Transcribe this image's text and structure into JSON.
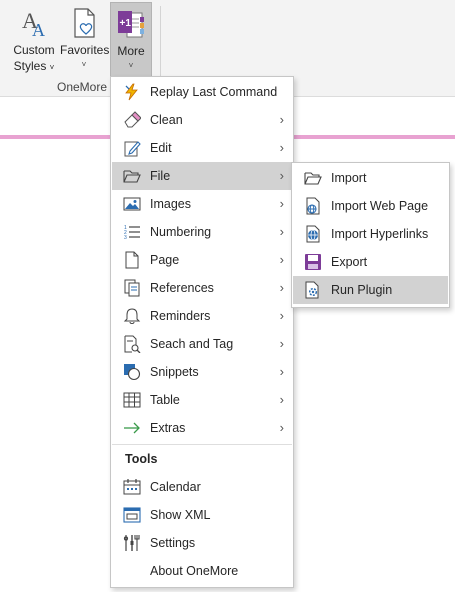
{
  "ribbon": {
    "buttons": [
      {
        "label": "Custom\nStyles",
        "label1": "Custom",
        "label2": "Styles",
        "icon": "custom-styles-icon",
        "chevron": "˅"
      },
      {
        "label": "Favorites",
        "icon": "favorites-icon",
        "chevron": "˅"
      },
      {
        "label": "More",
        "icon": "onenote-more-icon",
        "chevron": "˅"
      }
    ],
    "group_label": "OneMore"
  },
  "menu": {
    "items": [
      {
        "label": "Replay Last Command",
        "icon": "lightning-icon",
        "submenu": false
      },
      {
        "label": "Clean",
        "icon": "eraser-icon",
        "submenu": true
      },
      {
        "label": "Edit",
        "icon": "pencil-icon",
        "submenu": true
      },
      {
        "label": "File",
        "icon": "folder-icon",
        "submenu": true,
        "highlighted": true
      },
      {
        "label": "Images",
        "icon": "image-icon",
        "submenu": true
      },
      {
        "label": "Numbering",
        "icon": "numbered-list-icon",
        "submenu": true
      },
      {
        "label": "Page",
        "icon": "page-icon",
        "submenu": true
      },
      {
        "label": "References",
        "icon": "references-icon",
        "submenu": true
      },
      {
        "label": "Reminders",
        "icon": "bell-icon",
        "submenu": true
      },
      {
        "label": "Seach and Tag",
        "icon": "search-tag-icon",
        "submenu": true
      },
      {
        "label": "Snippets",
        "icon": "snippets-icon",
        "submenu": true
      },
      {
        "label": "Table",
        "icon": "table-icon",
        "submenu": true
      },
      {
        "label": "Extras",
        "icon": "arrow-right-icon",
        "submenu": true
      }
    ],
    "tools_header": "Tools",
    "tools": [
      {
        "label": "Calendar",
        "icon": "calendar-icon"
      },
      {
        "label": "Show XML",
        "icon": "xml-window-icon"
      },
      {
        "label": "Settings",
        "icon": "settings-tools-icon"
      },
      {
        "label": "About OneMore",
        "icon": ""
      }
    ]
  },
  "submenu": {
    "items": [
      {
        "label": "Import",
        "icon": "folder-open-icon"
      },
      {
        "label": "Import Web Page",
        "icon": "web-page-icon"
      },
      {
        "label": "Import Hyperlinks",
        "icon": "hyperlinks-icon"
      },
      {
        "label": "Export",
        "icon": "save-export-icon"
      },
      {
        "label": "Run Plugin",
        "icon": "plugin-icon",
        "highlighted": true
      }
    ]
  },
  "colors": {
    "ribbon_bg": "#f3f3f3",
    "highlight": "#d2d2d2",
    "accent_blue": "#2b6cb0",
    "onenote_purple": "#7d3c98",
    "pink_rule": "#e8a2d1"
  }
}
